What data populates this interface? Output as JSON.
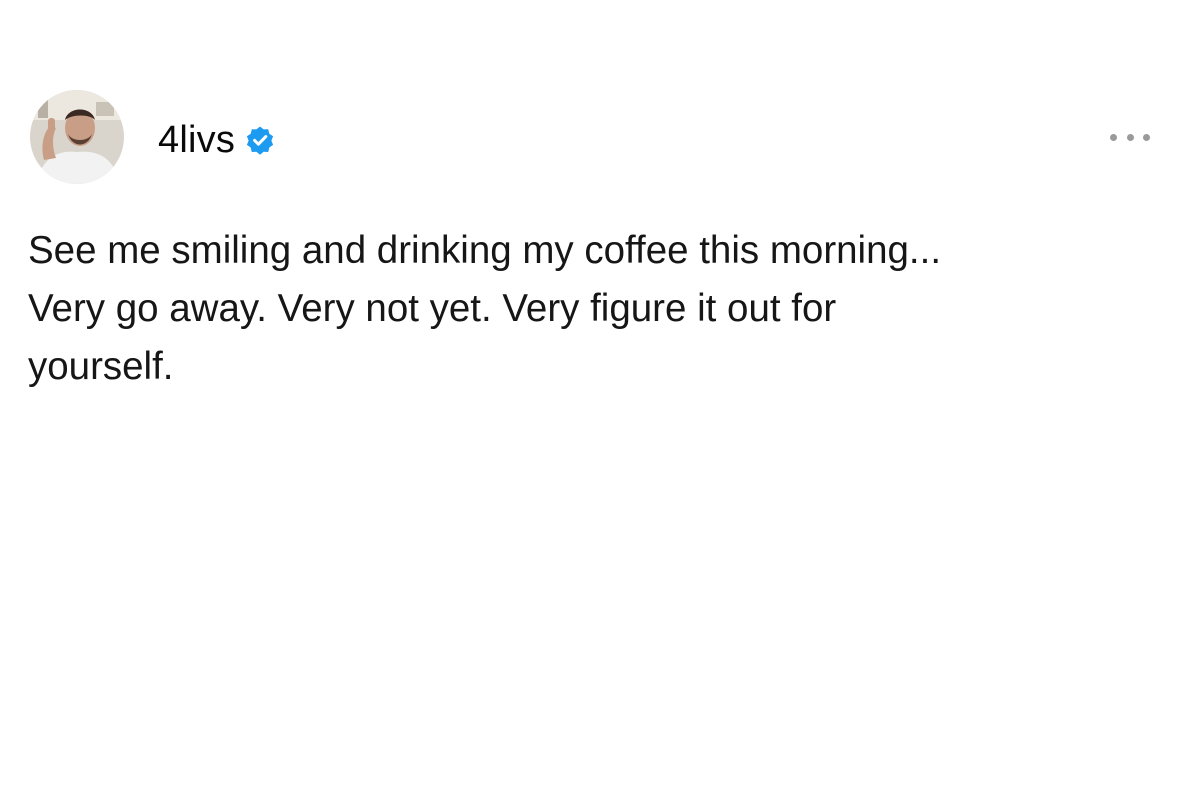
{
  "post": {
    "author": {
      "username": "4livs",
      "verified": true,
      "avatar_icon": "profile-photo",
      "verified_icon": "verified-badge-icon",
      "badge_color": "#1d9bf0"
    },
    "menu_icon": "more-horizontal-icon",
    "text": "See me smiling and drinking my coffee this morning...\nVery go away. Very not yet. Very figure it out for\nyourself."
  }
}
